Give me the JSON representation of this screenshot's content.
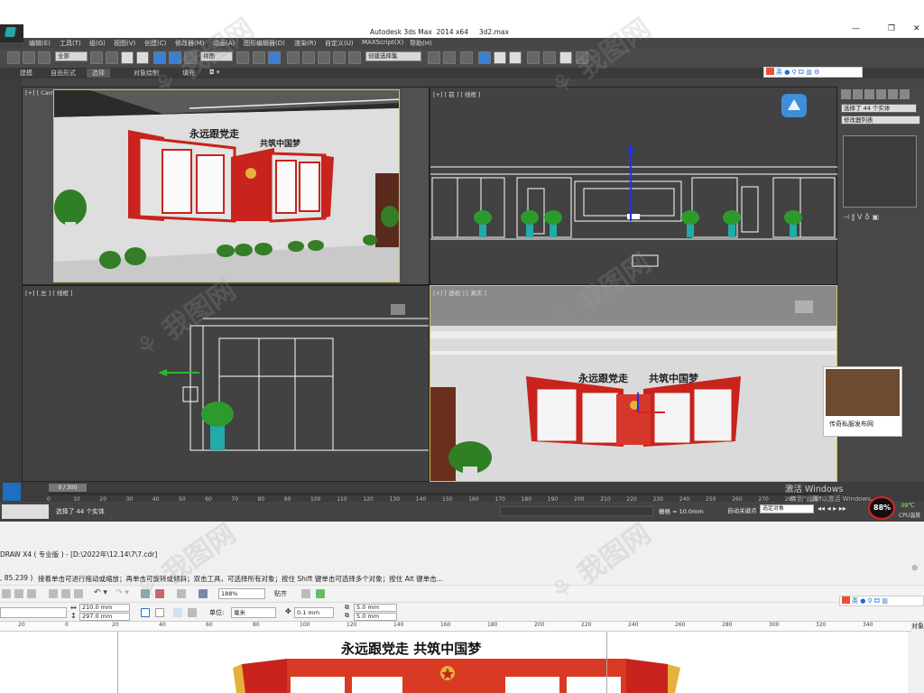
{
  "max": {
    "window_title": "Autodesk 3ds Max  2014 x64     3d2.max",
    "menu": [
      "编辑(E)",
      "工具(T)",
      "组(G)",
      "视图(V)",
      "创建(C)",
      "修改器(M)",
      "动画(A)",
      "图形编辑器(D)",
      "渲染(R)",
      "自定义(U)",
      "MAXScript(X)",
      "帮助(H)"
    ],
    "toolbar": {
      "filter_select": "全部",
      "view_select": "视图",
      "named_selection": "创建选择集"
    },
    "ribbon_tabs": [
      "建模",
      "自由形式",
      "选择",
      "对象绘制",
      "填充"
    ],
    "ribbon_active": "选择",
    "viewports": {
      "top_left": "[+] [ Camera",
      "top_right": "[+] [ 前 ] [ 线框 ]",
      "bottom_left": "[+] [ 左 ] [ 线框 ]",
      "bottom_right": "[+] [ 透视 ] [ 真实 ]"
    },
    "scene_text": {
      "left": "永远跟党走",
      "right": "共筑中国梦"
    },
    "command_panel": {
      "selection": "选择了 44 个实体",
      "list": "修改器列表"
    },
    "timeline": {
      "frame": "0 / 300",
      "ticks": [
        "0",
        "10",
        "20",
        "30",
        "40",
        "50",
        "60",
        "70",
        "80",
        "90",
        "100",
        "110",
        "120",
        "130",
        "140",
        "150",
        "160",
        "170",
        "180",
        "190",
        "200",
        "210",
        "220",
        "230",
        "240",
        "250",
        "260",
        "270",
        "280",
        "290"
      ]
    },
    "status": {
      "selected": "选择了 44 个实体",
      "grid": "栅格 = 10.0mm",
      "auto_key": "自动关键点",
      "set_key_select": "选定对象",
      "temperature": "39℃",
      "cpu_label": "CPU温度",
      "cpu_percent": "88%"
    },
    "activate": {
      "line1": "激活 Windows",
      "line2": "转到\"设置\"以激活 Windows。"
    },
    "popup": {
      "caption": "传奇私服发布网"
    }
  },
  "ime": {
    "label": "英"
  },
  "corel": {
    "title": "DRAW X4 ( 专业版 ) - [D:\\2022年\\12.14\\7\\7.cdr]",
    "coords": ", 85.239 )",
    "hint": "接着单击可进行拖动或缩放；再单击可旋转或倾斜；双击工具，可选择所有对象；按住 Shift 键单击可选择多个对象；按住 Alt 键单击...",
    "zoom": "188%",
    "snap": "贴齐",
    "width": "210.0 mm",
    "height": "297.0 mm",
    "unit_label": "单位:",
    "unit": "毫米",
    "nudge": "0.1 mm",
    "dup_x": "5.0 mm",
    "dup_y": "5.0 mm",
    "ruler": [
      "20",
      "0",
      "20",
      "40",
      "60",
      "80",
      "100",
      "120",
      "140",
      "160",
      "180",
      "200",
      "220",
      "240",
      "260",
      "280",
      "300",
      "320",
      "340"
    ],
    "docker_label": "对象",
    "design_text": "永远跟党走  共筑中国梦"
  },
  "colors": {
    "party_red": "#c8231c",
    "gold": "#e3b23c",
    "viewport_border": "#d8c74a"
  }
}
